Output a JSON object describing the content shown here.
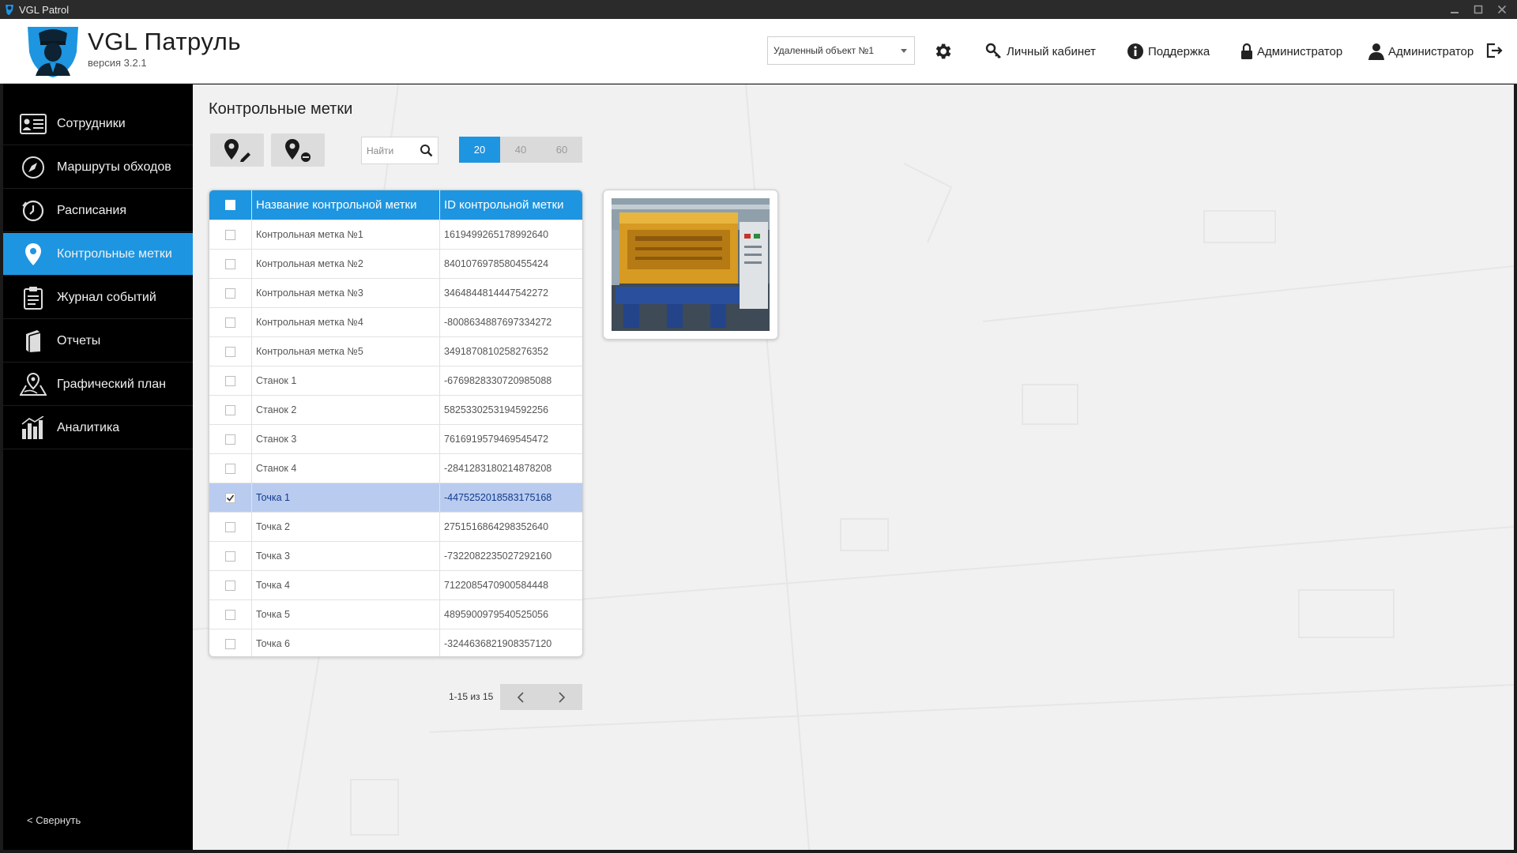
{
  "window": {
    "title": "VGL Patrol"
  },
  "header": {
    "brand_title": "VGL Патруль",
    "brand_version": "версия 3.2.1",
    "object_select": "Удаленный объект №1",
    "links": {
      "cabinet": "Личный кабинет",
      "support": "Поддержка",
      "admin_role": "Администратор",
      "admin_user": "Администратор"
    }
  },
  "sidebar": {
    "items": [
      {
        "label": "Сотрудники",
        "icon": "employees-icon"
      },
      {
        "label": "Маршруты обходов",
        "icon": "compass-icon"
      },
      {
        "label": "Расписания",
        "icon": "clock-icon"
      },
      {
        "label": "Контрольные метки",
        "icon": "map-pin-icon",
        "active": true
      },
      {
        "label": "Журнал событий",
        "icon": "clipboard-icon"
      },
      {
        "label": "Отчеты",
        "icon": "book-icon"
      },
      {
        "label": "Графический план",
        "icon": "map-plan-icon"
      },
      {
        "label": "Аналитика",
        "icon": "bar-chart-icon"
      }
    ],
    "collapse_label": "< Свернуть"
  },
  "main": {
    "page_title": "Контрольные метки",
    "search_placeholder": "Найти",
    "page_sizes": [
      "20",
      "40",
      "60"
    ],
    "selected_page_size": "20",
    "table": {
      "headers": [
        "Название контрольной метки",
        "ID контрольной метки"
      ],
      "rows": [
        {
          "name": "Контрольная метка №1",
          "id": "1619499265178992640",
          "checked": false
        },
        {
          "name": "Контрольная метка №2",
          "id": "8401076978580455424",
          "checked": false
        },
        {
          "name": "Контрольная метка №3",
          "id": "3464844814447542272",
          "checked": false
        },
        {
          "name": "Контрольная метка №4",
          "id": "-8008634887697334272",
          "checked": false
        },
        {
          "name": "Контрольная метка №5",
          "id": "3491870810258276352",
          "checked": false
        },
        {
          "name": "Станок 1",
          "id": "-6769828330720985088",
          "checked": false
        },
        {
          "name": "Станок 2",
          "id": "5825330253194592256",
          "checked": false
        },
        {
          "name": "Станок 3",
          "id": "7616919579469545472",
          "checked": false
        },
        {
          "name": "Станок 4",
          "id": "-2841283180214878208",
          "checked": false
        },
        {
          "name": "Точка 1",
          "id": "-4475252018583175168",
          "checked": true
        },
        {
          "name": "Точка 2",
          "id": "2751516864298352640",
          "checked": false
        },
        {
          "name": "Точка 3",
          "id": "-7322082235027292160",
          "checked": false
        },
        {
          "name": "Точка 4",
          "id": "7122085470900584448",
          "checked": false
        },
        {
          "name": "Точка 5",
          "id": "4895900979540525056",
          "checked": false
        },
        {
          "name": "Точка 6",
          "id": "-3244636821908357120",
          "checked": false
        }
      ]
    },
    "pager_text": "1-15 из 15"
  },
  "colors": {
    "accent": "#1e95e0",
    "selected_row": "#b9ccf0",
    "sidebar_bg": "#000000"
  }
}
